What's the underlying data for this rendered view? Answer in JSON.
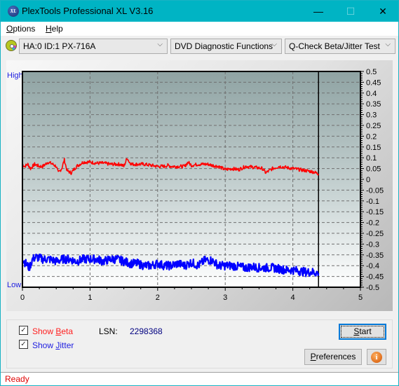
{
  "window": {
    "title": "PlexTools Professional XL V3.16",
    "icon": "xl-app-icon",
    "controls": {
      "minimize": "—",
      "maximize": "☐",
      "close": "✕"
    }
  },
  "menu": [
    {
      "label": "Options",
      "accel": "O"
    },
    {
      "label": "Help",
      "accel": "H"
    }
  ],
  "toolbar": {
    "drive_icon": "disc-icon",
    "drive": "HA:0 ID:1  PX-716A",
    "function": "DVD Diagnostic Functions",
    "test": "Q-Check Beta/Jitter Test",
    "chevron": "⌵"
  },
  "chart_labels": {
    "high": "High",
    "low": "Low"
  },
  "chart_data": {
    "type": "line",
    "title": "",
    "xlabel": "",
    "ylabel": "",
    "xlim": [
      0,
      5
    ],
    "ylim": [
      -0.5,
      0.5
    ],
    "x_ticks": [
      "0",
      "1",
      "2",
      "3",
      "4",
      "5"
    ],
    "y_ticks": [
      "0.5",
      "0.45",
      "0.4",
      "0.35",
      "0.3",
      "0.25",
      "0.2",
      "0.15",
      "0.1",
      "0.05",
      "0",
      "-0.05",
      "-0.1",
      "-0.15",
      "-0.2",
      "-0.25",
      "-0.3",
      "-0.35",
      "-0.4",
      "-0.45",
      "-0.5"
    ],
    "grid": true,
    "end_marker_x": 4.38,
    "series": [
      {
        "name": "Beta",
        "color": "#ff0000",
        "x": [
          0,
          0.03,
          0.08,
          0.12,
          0.18,
          0.25,
          0.3,
          0.38,
          0.45,
          0.5,
          0.53,
          0.58,
          0.62,
          0.66,
          0.72,
          0.8,
          0.9,
          1.0,
          1.1,
          1.2,
          1.3,
          1.45,
          1.5,
          1.55,
          1.58,
          1.62,
          1.7,
          1.8,
          1.9,
          2.0,
          2.1,
          2.15,
          2.2,
          2.3,
          2.4,
          2.45,
          2.5,
          2.6,
          2.75,
          2.8,
          2.9,
          3.0,
          3.1,
          3.2,
          3.3,
          3.45,
          3.55,
          3.6,
          3.7,
          3.8,
          3.9,
          4.0,
          4.1,
          4.2,
          4.3,
          4.38
        ],
        "values": [
          0.07,
          0.06,
          0.07,
          0.05,
          0.07,
          0.06,
          0.06,
          0.08,
          0.07,
          0.06,
          0.03,
          0.05,
          0.09,
          0.04,
          0.03,
          0.06,
          0.08,
          0.08,
          0.075,
          0.075,
          0.07,
          0.07,
          0.06,
          0.1,
          0.08,
          0.07,
          0.07,
          0.07,
          0.065,
          0.06,
          0.06,
          0.065,
          0.06,
          0.06,
          0.06,
          0.08,
          0.065,
          0.07,
          0.07,
          0.065,
          0.06,
          0.045,
          0.05,
          0.045,
          0.06,
          0.055,
          0.05,
          0.03,
          0.05,
          0.06,
          0.055,
          0.05,
          0.045,
          0.04,
          0.035,
          0.025
        ]
      },
      {
        "name": "Jitter",
        "color": "#0000ff",
        "x": [
          0,
          0.05,
          0.1,
          0.15,
          0.2,
          0.3,
          0.4,
          0.5,
          0.6,
          0.7,
          0.8,
          0.9,
          1.0,
          1.1,
          1.2,
          1.3,
          1.4,
          1.5,
          1.6,
          1.7,
          1.8,
          1.9,
          2.0,
          2.1,
          2.2,
          2.3,
          2.4,
          2.5,
          2.6,
          2.7,
          2.8,
          2.9,
          3.0,
          3.1,
          3.2,
          3.3,
          3.4,
          3.5,
          3.6,
          3.7,
          3.8,
          3.9,
          4.0,
          4.1,
          4.2,
          4.3,
          4.38
        ],
        "values": [
          -0.37,
          -0.39,
          -0.41,
          -0.37,
          -0.36,
          -0.37,
          -0.37,
          -0.38,
          -0.37,
          -0.37,
          -0.38,
          -0.37,
          -0.37,
          -0.37,
          -0.38,
          -0.37,
          -0.37,
          -0.38,
          -0.39,
          -0.39,
          -0.4,
          -0.4,
          -0.39,
          -0.4,
          -0.4,
          -0.39,
          -0.4,
          -0.385,
          -0.4,
          -0.375,
          -0.375,
          -0.4,
          -0.4,
          -0.4,
          -0.405,
          -0.41,
          -0.405,
          -0.41,
          -0.41,
          -0.41,
          -0.415,
          -0.42,
          -0.42,
          -0.425,
          -0.43,
          -0.43,
          -0.435
        ]
      }
    ]
  },
  "controls": {
    "show_beta": {
      "label": "Show Beta",
      "accel": "B",
      "checked": true,
      "color": "#ff0000"
    },
    "show_jitter": {
      "label": "Show Jitter",
      "accel": "J",
      "checked": true,
      "color": "#0000ff"
    },
    "lsn_label": "LSN:",
    "lsn_value": "2298368",
    "start": "Start",
    "preferences": "Preferences",
    "info_icon": "i"
  },
  "status": {
    "text": "Ready"
  }
}
